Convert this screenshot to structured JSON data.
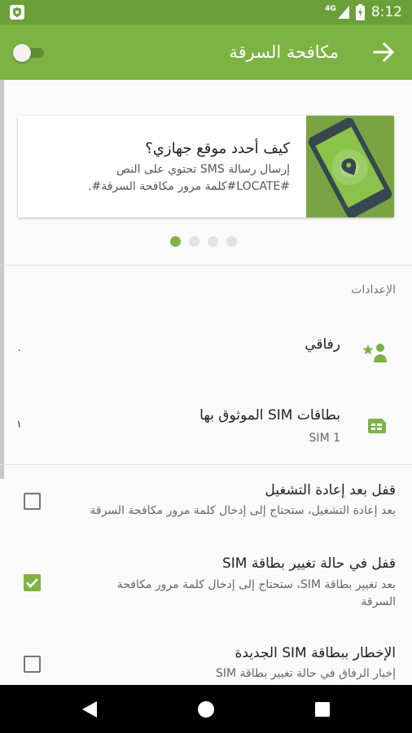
{
  "status_bar": {
    "network": "4G",
    "time": "8:12"
  },
  "toolbar": {
    "title": "مكافحة السرقة",
    "toggle_on": false
  },
  "info_card": {
    "title": "كيف أحدد موقع جهازي؟",
    "body": "إرسال رسالة SMS تحتوي على النص #LOCATE#كلمة مرور مكافحة السرقة#."
  },
  "pager": {
    "count": 4,
    "active_index": 0
  },
  "settings": {
    "header": "الإعدادات",
    "items": [
      {
        "title": "رفاقي",
        "value": "٠",
        "icon": "buddies-icon"
      },
      {
        "title": "بطاقات SIM الموثوق بها",
        "subtitle": "SIM 1",
        "value": "١",
        "icon": "sim-card-icon"
      }
    ],
    "checkbox_items": [
      {
        "title": "قفل بعد إعادة التشغيل",
        "subtitle": "بعد إعادة التشغيل، ستحتاج إلى إدخال كلمة مرور مكافحة السرقة",
        "checked": false
      },
      {
        "title": "قفل في حالة تغيير بطاقة SIM",
        "subtitle": "بعد تغيير بطاقة SIM، ستحتاج إلى إدخال كلمة مرور مكافحة السرقة",
        "checked": true
      },
      {
        "title": "الإخطار ببطاقة SIM الجديدة",
        "subtitle": "إخبار الرفاق في حالة تغيير بطاقة SIM",
        "checked": false
      }
    ]
  },
  "colors": {
    "accent": "#7cb342",
    "status_bar": "#6a9f3a"
  }
}
